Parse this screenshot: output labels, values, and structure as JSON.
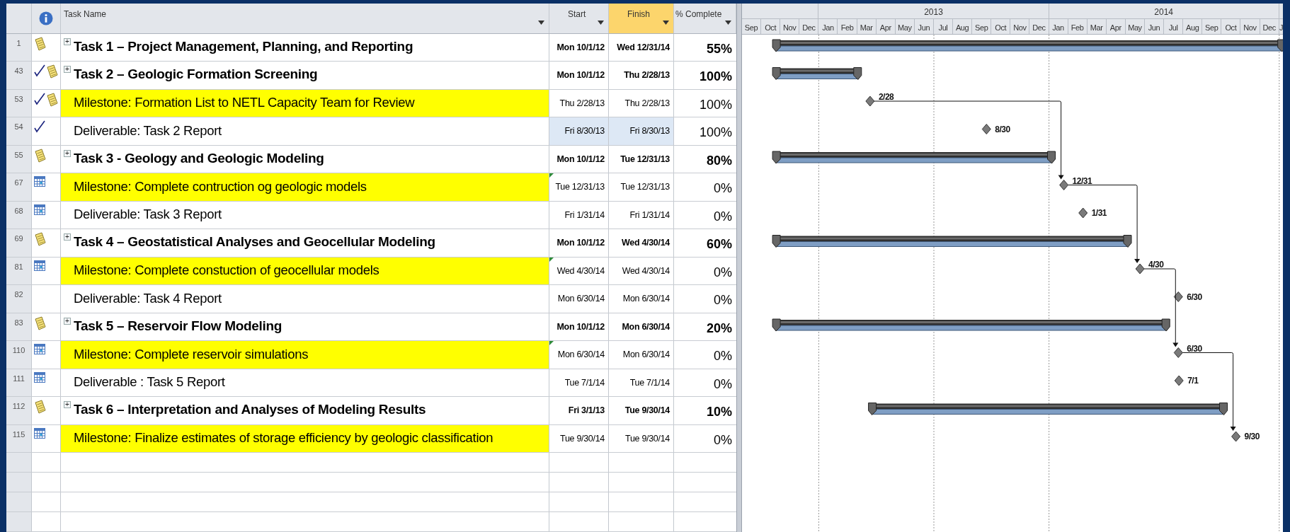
{
  "columns": [
    {
      "label": "Task Name",
      "selected": false
    },
    {
      "label": "Start",
      "selected": false
    },
    {
      "label": "Finish",
      "selected": true
    },
    {
      "label": "% Complete",
      "selected": false
    }
  ],
  "timeline": {
    "years": [
      "2013",
      "2014"
    ],
    "months": [
      "Sep",
      "Oct",
      "Nov",
      "Dec",
      "Jan",
      "Feb",
      "Mar",
      "Apr",
      "May",
      "Jun",
      "Jul",
      "Aug",
      "Sep",
      "Oct",
      "Nov",
      "Dec",
      "Jan",
      "Feb",
      "Mar",
      "Apr",
      "May",
      "Jun",
      "Jul",
      "Aug",
      "Sep",
      "Oct",
      "Nov",
      "Dec",
      "J"
    ]
  },
  "rows": [
    {
      "id": "1",
      "completed": false,
      "note": true,
      "calendar": false,
      "kind": "summary",
      "toggle": "+",
      "name": "Task 1 –  Project Management, Planning, and Reporting",
      "start": "Mon 10/1/12",
      "finish": "Wed 12/31/14",
      "complete": "55%"
    },
    {
      "id": "43",
      "completed": true,
      "note": true,
      "calendar": false,
      "kind": "summary",
      "toggle": "+",
      "name": "Task 2 – Geologic Formation Screening",
      "start": "Mon 10/1/12",
      "finish": "Thu 2/28/13",
      "complete": "100%"
    },
    {
      "id": "53",
      "completed": true,
      "note": true,
      "calendar": false,
      "kind": "milestone",
      "name": "Milestone: Formation List to NETL Capacity Team for Review",
      "start": "Thu 2/28/13",
      "finish": "Thu 2/28/13",
      "complete": "100%",
      "gantt_label": "2/28",
      "link": true
    },
    {
      "id": "54",
      "completed": true,
      "note": false,
      "calendar": false,
      "kind": "deliverable",
      "name": "Deliverable: Task 2 Report",
      "start": "Fri 8/30/13",
      "finish": "Fri 8/30/13",
      "complete": "100%",
      "dates_highlighted": true,
      "gantt_label": "8/30"
    },
    {
      "id": "55",
      "completed": false,
      "note": true,
      "calendar": false,
      "kind": "summary",
      "toggle": "+",
      "name": "Task 3 - Geology and Geologic Modeling",
      "start": "Mon 10/1/12",
      "finish": "Tue 12/31/13",
      "complete": "80%"
    },
    {
      "id": "67",
      "completed": false,
      "note": false,
      "calendar": true,
      "kind": "milestone",
      "name": "Milestone: Complete contruction og geologic models",
      "start": "Tue 12/31/13",
      "finish": "Tue 12/31/13",
      "complete": "0%",
      "flagged": true,
      "gantt_label": "12/31",
      "link": true
    },
    {
      "id": "68",
      "completed": false,
      "note": false,
      "calendar": true,
      "kind": "deliverable",
      "name": "Deliverable: Task 3 Report",
      "start": "Fri 1/31/14",
      "finish": "Fri 1/31/14",
      "complete": "0%",
      "gantt_label": "1/31"
    },
    {
      "id": "69",
      "completed": false,
      "note": true,
      "calendar": false,
      "kind": "summary",
      "toggle": "+",
      "name": "Task 4 – Geostatistical Analyses and Geocellular Modeling",
      "start": "Mon 10/1/12",
      "finish": "Wed 4/30/14",
      "complete": "60%"
    },
    {
      "id": "81",
      "completed": false,
      "note": false,
      "calendar": true,
      "kind": "milestone",
      "name": "Milestone: Complete constuction of geocellular models",
      "start": "Wed 4/30/14",
      "finish": "Wed 4/30/14",
      "complete": "0%",
      "flagged": true,
      "gantt_label": "4/30",
      "link": true
    },
    {
      "id": "82",
      "completed": false,
      "note": false,
      "calendar": false,
      "kind": "deliverable",
      "name": "Deliverable: Task 4 Report",
      "start": "Mon 6/30/14",
      "finish": "Mon 6/30/14",
      "complete": "0%",
      "gantt_label": "6/30"
    },
    {
      "id": "83",
      "completed": false,
      "note": true,
      "calendar": false,
      "kind": "summary",
      "toggle": "+",
      "name": "Task 5 – Reservoir Flow Modeling",
      "start": "Mon 10/1/12",
      "finish": "Mon 6/30/14",
      "complete": "20%"
    },
    {
      "id": "110",
      "completed": false,
      "note": false,
      "calendar": true,
      "kind": "milestone",
      "name": "Milestone: Complete reservoir simulations",
      "start": "Mon 6/30/14",
      "finish": "Mon 6/30/14",
      "complete": "0%",
      "flagged": true,
      "gantt_label": "6/30",
      "link": true
    },
    {
      "id": "111",
      "completed": false,
      "note": false,
      "calendar": true,
      "kind": "deliverable",
      "name": "Deliverable : Task 5 Report",
      "start": "Tue 7/1/14",
      "finish": "Tue 7/1/14",
      "complete": "0%",
      "gantt_label": "7/1"
    },
    {
      "id": "112",
      "completed": false,
      "note": true,
      "calendar": false,
      "kind": "summary",
      "toggle": "+",
      "name": "Task 6 – Interpretation and Analyses of Modeling Results",
      "start": "Fri 3/1/13",
      "finish": "Tue 9/30/14",
      "complete": "10%"
    },
    {
      "id": "115",
      "completed": false,
      "note": false,
      "calendar": true,
      "kind": "milestone",
      "name": "Milestone: Finalize estimates of storage efficiency by geologic classification",
      "start": "Tue 9/30/14",
      "finish": "Tue 9/30/14",
      "complete": "0%",
      "gantt_label": "9/30"
    }
  ]
}
